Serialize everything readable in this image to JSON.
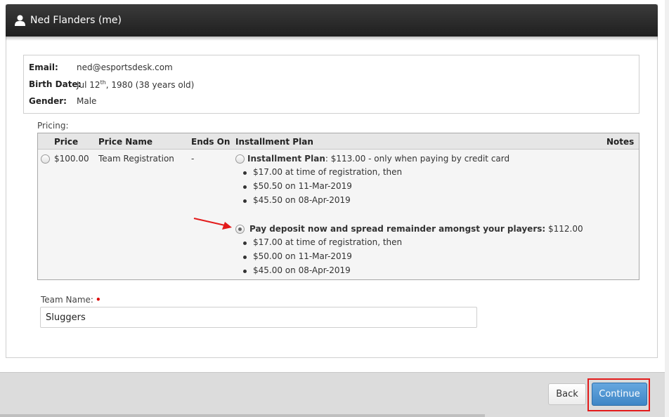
{
  "header": {
    "title": "Ned Flanders (me)",
    "icon": "user-icon"
  },
  "info": {
    "email_label": "Email:",
    "email_value": "ned@esportsdesk.com",
    "birth_label": "Birth Date:",
    "birth_prefix": "Jul 12",
    "birth_suffix": "th",
    "birth_rest": ", 1980 (38 years old)",
    "gender_label": "Gender:",
    "gender_value": "Male"
  },
  "pricing": {
    "label": "Pricing:",
    "columns": {
      "price": "Price",
      "price_name": "Price Name",
      "ends_on": "Ends On",
      "installment_plan": "Installment Plan",
      "notes": "Notes"
    },
    "row": {
      "price": "$100.00",
      "price_name": "Team Registration",
      "ends_on": "-",
      "selected": false
    },
    "plans": [
      {
        "name": "Installment Plan",
        "detail": ": $113.00 - only when paying by credit card",
        "selected": false,
        "steps": [
          "$17.00 at time of registration, then",
          "$50.50 on 11-Mar-2019",
          "$45.50 on 08-Apr-2019"
        ]
      },
      {
        "name": "Pay deposit now and spread remainder amongst your players:",
        "detail": " $112.00",
        "selected": true,
        "steps": [
          "$17.00 at time of registration, then",
          "$50.00 on 11-Mar-2019",
          "$45.00 on 08-Apr-2019"
        ]
      }
    ]
  },
  "team": {
    "label": "Team Name:",
    "required_mark": "•",
    "value": "Sluggers"
  },
  "buttons": {
    "back": "Back",
    "continue": "Continue"
  },
  "colors": {
    "header_bg": "#2b2b2b",
    "continue_bg": "#4a90d0",
    "highlight": "#e31b1b",
    "arrow": "#e31b1b"
  }
}
